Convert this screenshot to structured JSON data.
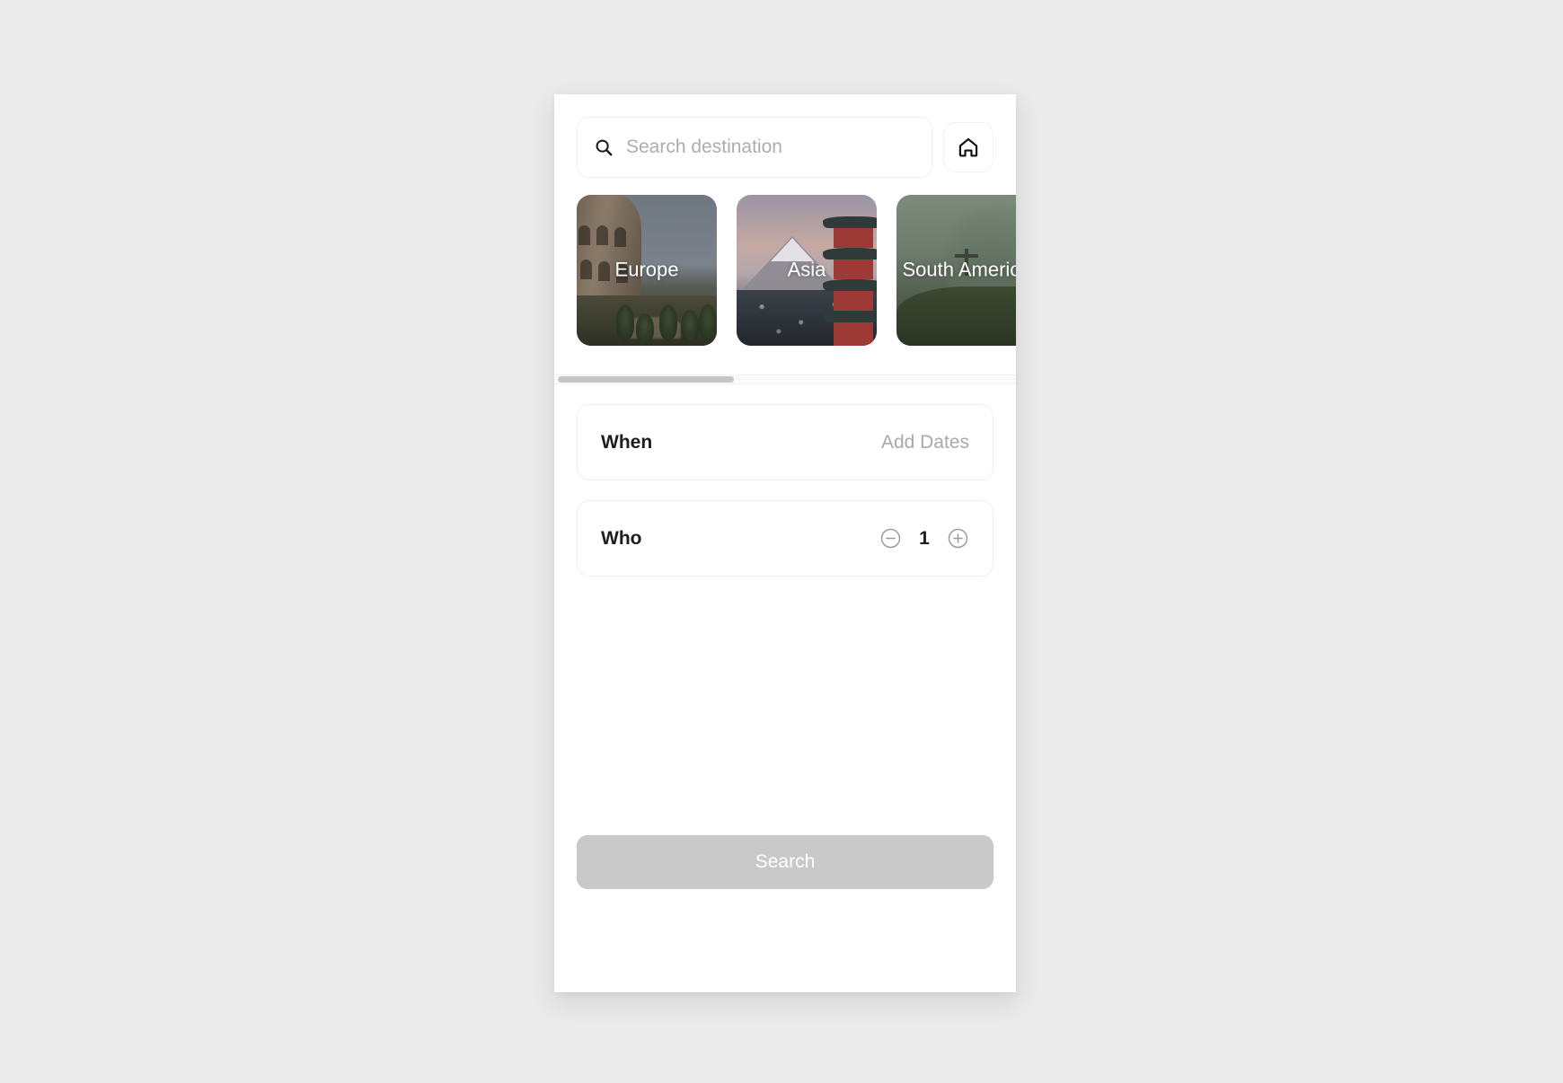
{
  "search": {
    "placeholder": "Search destination",
    "value": "",
    "icon": "search-icon",
    "home_button_icon": "home-icon"
  },
  "destinations": {
    "scroll_position_percent": 38,
    "items": [
      {
        "label": "Europe",
        "art": "colosseum"
      },
      {
        "label": "Asia",
        "art": "mount-fuji-pagoda"
      },
      {
        "label": "South America",
        "art": "rio-mountain"
      }
    ]
  },
  "options": {
    "when": {
      "label": "When",
      "value": "Add Dates"
    },
    "who": {
      "label": "Who",
      "count": "1",
      "decrement_icon": "minus-circle-icon",
      "increment_icon": "plus-circle-icon"
    }
  },
  "footer": {
    "search_label": "Search",
    "search_disabled": true
  },
  "colors": {
    "background": "#eaeaea",
    "panel": "#ffffff",
    "text_primary": "#1d1d1d",
    "text_muted": "#a9a9a9",
    "border": "#f0f0f0",
    "button_disabled": "#c9c9c9",
    "scroll_thumb": "#c6c6c6"
  }
}
